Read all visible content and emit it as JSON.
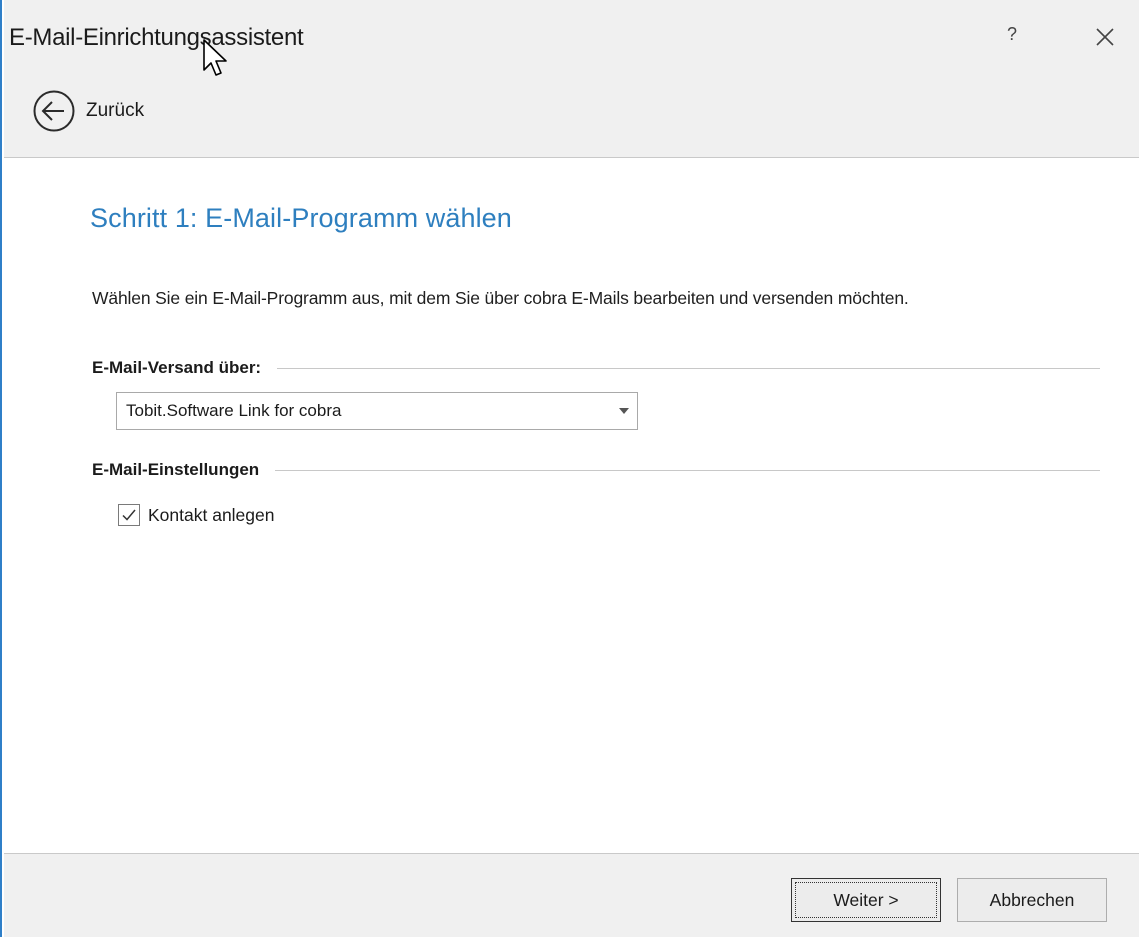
{
  "window": {
    "title": "E-Mail-Einrichtungsassistent",
    "help_label": "?",
    "close_icon": "close-icon"
  },
  "nav": {
    "back_label": "Zurück",
    "back_icon": "arrow-left-circle-icon"
  },
  "main": {
    "step_title": "Schritt 1: E-Mail-Programm wählen",
    "description": "Wählen Sie ein E-Mail-Programm aus, mit dem Sie über cobra E-Mails bearbeiten und versenden möchten.",
    "send_section_label": "E-Mail-Versand über:",
    "send_select_value": "Tobit.Software Link for cobra",
    "settings_section_label": "E-Mail-Einstellungen",
    "create_contact_label": "Kontakt anlegen",
    "create_contact_checked": true
  },
  "footer": {
    "next_label": "Weiter >",
    "cancel_label": "Abbrechen"
  },
  "colors": {
    "accent": "#2e7fbf",
    "window_border": "#2f7fc8",
    "chrome_bg": "#f0f0f0"
  }
}
